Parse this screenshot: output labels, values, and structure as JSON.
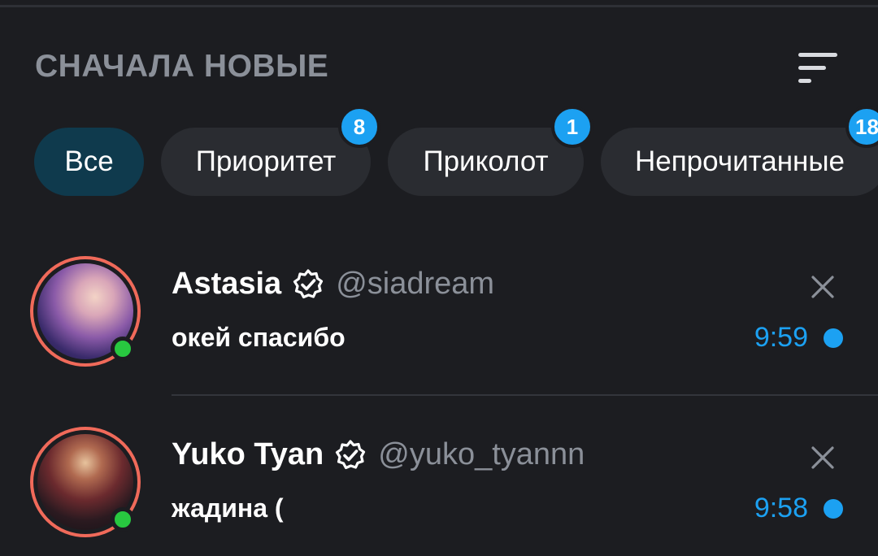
{
  "header": {
    "sort_title": "СНАЧАЛА НОВЫЕ",
    "sort_icon": "sort-lines-icon"
  },
  "filters": [
    {
      "label": "Все",
      "active": true,
      "badge": ""
    },
    {
      "label": "Приоритет",
      "active": false,
      "badge": "8"
    },
    {
      "label": "Приколот",
      "active": false,
      "badge": "1"
    },
    {
      "label": "Непрочитанные",
      "active": false,
      "badge": "18"
    }
  ],
  "chats": [
    {
      "name": "Astasia",
      "handle": "@siadream",
      "message": "окей спасибо",
      "time": "9:59",
      "verified": true,
      "online": true,
      "unread": true
    },
    {
      "name": "Yuko Tyan",
      "handle": "@yuko_tyannn",
      "message": "жадина (",
      "time": "9:58",
      "verified": true,
      "online": true,
      "unread": true
    }
  ],
  "colors": {
    "background": "#1c1d21",
    "chip": "#2a2c31",
    "chip_active": "#0f3a4d",
    "accent": "#1ca1f2",
    "muted_text": "#8b9099",
    "avatar_ring": "#f06a5a",
    "online": "#28c840"
  }
}
